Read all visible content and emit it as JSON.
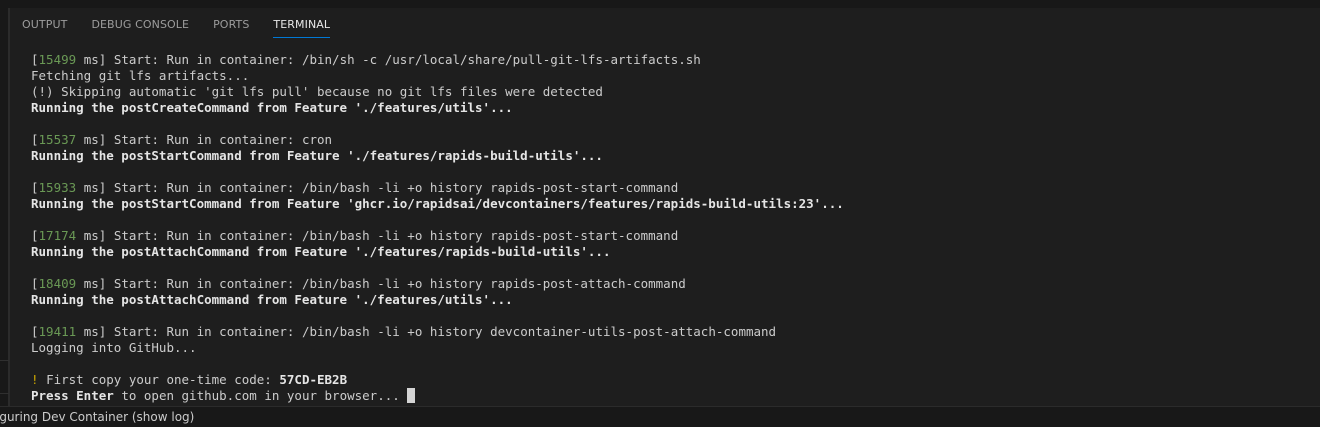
{
  "panel": {
    "tabs": [
      {
        "label": "OUTPUT",
        "active": false
      },
      {
        "label": "DEBUG CONSOLE",
        "active": false
      },
      {
        "label": "PORTS",
        "active": false
      },
      {
        "label": "TERMINAL",
        "active": true
      }
    ]
  },
  "terminal": {
    "lines": [
      {
        "ms": "15499",
        "text": "Start: Run in container: /bin/sh -c /usr/local/share/pull-git-lfs-artifacts.sh"
      },
      {
        "text": "Fetching git lfs artifacts..."
      },
      {
        "text": "(!) Skipping automatic 'git lfs pull' because no git lfs files were detected"
      },
      {
        "text": "Running the postCreateCommand from Feature './features/utils'...",
        "bold": true
      },
      {
        "text": ""
      },
      {
        "ms": "15537",
        "text": "Start: Run in container: cron"
      },
      {
        "text": "Running the postStartCommand from Feature './features/rapids-build-utils'...",
        "bold": true
      },
      {
        "text": ""
      },
      {
        "ms": "15933",
        "text": "Start: Run in container: /bin/bash -li +o history rapids-post-start-command"
      },
      {
        "text": "Running the postStartCommand from Feature 'ghcr.io/rapidsai/devcontainers/features/rapids-build-utils:23'...",
        "bold": true
      },
      {
        "text": ""
      },
      {
        "ms": "17174",
        "text": "Start: Run in container: /bin/bash -li +o history rapids-post-start-command"
      },
      {
        "text": "Running the postAttachCommand from Feature './features/rapids-build-utils'...",
        "bold": true
      },
      {
        "text": ""
      },
      {
        "ms": "18409",
        "text": "Start: Run in container: /bin/bash -li +o history rapids-post-attach-command"
      },
      {
        "text": "Running the postAttachCommand from Feature './features/utils'...",
        "bold": true
      },
      {
        "text": ""
      },
      {
        "ms": "19411",
        "text": "Start: Run in container: /bin/bash -li +o history devcontainer-utils-post-attach-command"
      },
      {
        "text": "Logging into GitHub..."
      },
      {
        "text": ""
      },
      {
        "type": "code",
        "prefix": "!",
        "text": "First copy your one-time code:",
        "code": "57CD-EB2B"
      },
      {
        "type": "prompt",
        "key": "Press Enter",
        "text": "to open github.com in your browser..."
      }
    ]
  },
  "statusbar": {
    "text": "iguring Dev Container (show log)"
  },
  "colors": {
    "background": "#1e1e1e",
    "ms_highlight": "#6a9955",
    "warn": "#cca700",
    "tab_active_underline": "#0078d4"
  }
}
